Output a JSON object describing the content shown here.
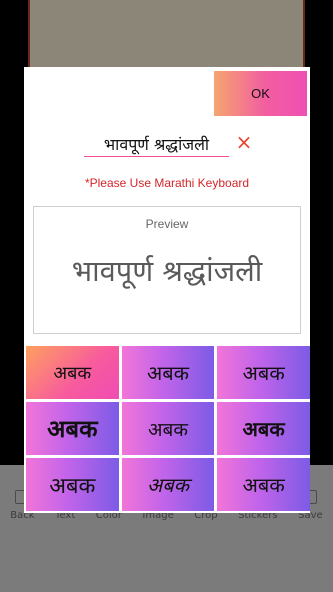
{
  "background": {
    "toolbar": [
      {
        "label": "Back",
        "icon": "back-icon"
      },
      {
        "label": "Text",
        "icon": "text-icon"
      },
      {
        "label": "Color",
        "icon": "color-icon"
      },
      {
        "label": "Image",
        "icon": "image-icon"
      },
      {
        "label": "Crop",
        "icon": "crop-icon"
      },
      {
        "label": "Stickers",
        "icon": "stickers-icon"
      },
      {
        "label": "Save",
        "icon": "save-icon"
      }
    ]
  },
  "dialog": {
    "ok_label": "OK",
    "input_value": "भावपूर्ण श्रद्धांजली",
    "clear_icon": "×",
    "hint": "*Please Use Marathi Keyboard",
    "preview_title": "Preview",
    "preview_text": "भावपूर्ण श्रद्धांजली",
    "font_samples": [
      "अबक",
      "अबक",
      "अबक",
      "अबक",
      "अबक",
      "अबक",
      "अबक",
      "अबक",
      "अबक"
    ],
    "selected_index": 0
  },
  "colors": {
    "accent_pink": "#f25ea0",
    "hint_red": "#d3262a",
    "tile_purple": "#9b5fe8"
  }
}
